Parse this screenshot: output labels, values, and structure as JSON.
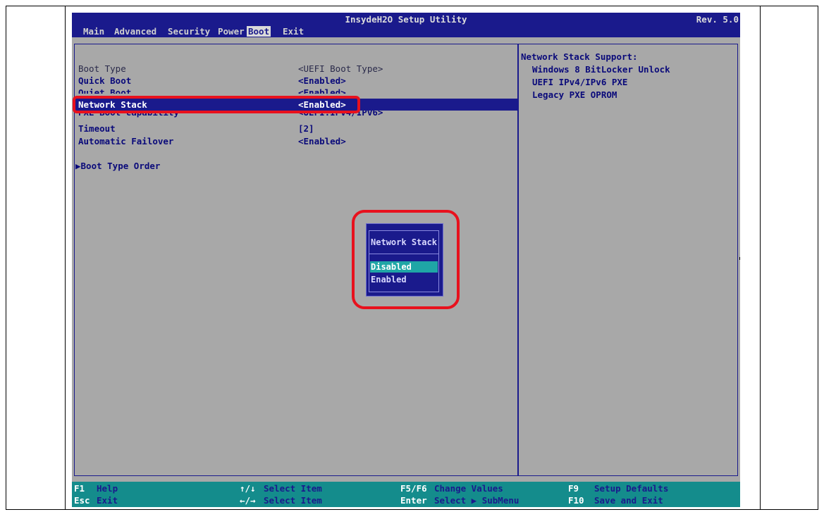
{
  "title": "InsydeH2O Setup Utility",
  "revision": "Rev. 5.0",
  "menu": [
    "Main",
    "Advanced",
    "Security",
    "Power",
    "Boot",
    "Exit"
  ],
  "active_menu": "Boot",
  "settings": [
    {
      "label": "Boot Type",
      "value": "<UEFI Boot Type>"
    },
    {
      "label": "Quick Boot",
      "value": "<Enabled>"
    },
    {
      "label": "Quiet Boot",
      "value": "<Enabled>"
    },
    {
      "label": "Network Stack",
      "value": "<Enabled>"
    },
    {
      "label": "PXE Boot capability",
      "value": "<UEFI:IPv4/IPv6>"
    },
    {
      "label": "Timeout",
      "value": "[2]"
    },
    {
      "label": "Automatic Failover",
      "value": "<Enabled>"
    }
  ],
  "submenu": {
    "arrow": "▶",
    "label": "Boot Type Order"
  },
  "help": {
    "title": "Network Stack Support:",
    "lines": [
      "Windows 8 BitLocker Unlock",
      "UEFI IPv4/IPv6 PXE",
      "Legacy PXE OPROM"
    ]
  },
  "popup": {
    "title": "Network Stack",
    "options": [
      "Disabled",
      "Enabled"
    ],
    "selected": "Disabled"
  },
  "footer": [
    {
      "key": "F1",
      "desc": "Help"
    },
    {
      "key": "Esc",
      "desc": "Exit"
    },
    {
      "key": "↑/↓",
      "desc": "Select Item"
    },
    {
      "key": "←/→",
      "desc": "Select Item"
    },
    {
      "key": "F5/F6",
      "desc": "Change Values"
    },
    {
      "key": "Enter",
      "desc": "Select ▶ SubMenu"
    },
    {
      "key": "F9",
      "desc": "Setup Defaults"
    },
    {
      "key": "F10",
      "desc": "Save and Exit"
    }
  ],
  "colors": {
    "bios_blue": "#1a1a8c",
    "bios_gray": "#a8a8a8",
    "footer_teal": "#148c8c",
    "popup_selected": "#1fa6a6",
    "highlight_red": "#e8111d"
  }
}
